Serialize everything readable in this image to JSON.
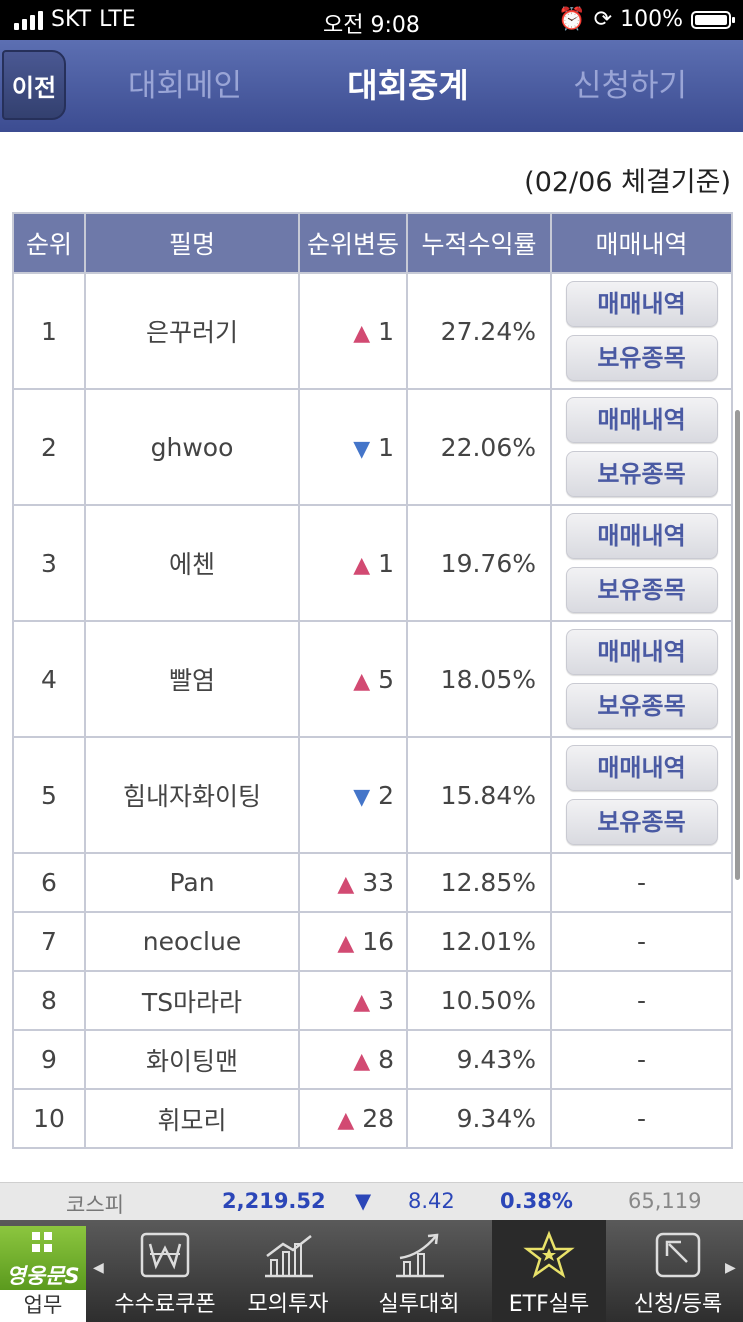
{
  "status_bar": {
    "carrier": "SKT",
    "network": "LTE",
    "time": "오전 9:08",
    "battery": "100%"
  },
  "nav": {
    "back_label": "이전",
    "tabs": [
      "대회메인",
      "대회중계",
      "신청하기"
    ],
    "active_tab": "대회중계"
  },
  "basis": "(02/06 체결기준)",
  "table": {
    "headers": [
      "순위",
      "필명",
      "순위변동",
      "누적수익률",
      "매매내역"
    ],
    "rows": [
      {
        "rank": "1",
        "name": "은꾸러기",
        "dir": "▲",
        "change": "1",
        "rate": "27.24%",
        "btn1": "매매내역",
        "btn2": "보유종목"
      },
      {
        "rank": "2",
        "name": "ghwoo",
        "dir": "▼",
        "change": "1",
        "rate": "22.06%",
        "btn1": "매매내역",
        "btn2": "보유종목"
      },
      {
        "rank": "3",
        "name": "에첸",
        "dir": "▲",
        "change": "1",
        "rate": "19.76%",
        "btn1": "매매내역",
        "btn2": "보유종목"
      },
      {
        "rank": "4",
        "name": "빨염",
        "dir": "▲",
        "change": "5",
        "rate": "18.05%",
        "btn1": "매매내역",
        "btn2": "보유종목"
      },
      {
        "rank": "5",
        "name": "힘내자화이팅",
        "dir": "▼",
        "change": "2",
        "rate": "15.84%",
        "btn1": "매매내역",
        "btn2": "보유종목"
      },
      {
        "rank": "6",
        "name": "Pan",
        "dir": "▲",
        "change": "33",
        "rate": "12.85%",
        "trades": "-"
      },
      {
        "rank": "7",
        "name": "neoclue",
        "dir": "▲",
        "change": "16",
        "rate": "12.01%",
        "trades": "-"
      },
      {
        "rank": "8",
        "name": "TS마라라",
        "dir": "▲",
        "change": "3",
        "rate": "10.50%",
        "trades": "-"
      },
      {
        "rank": "9",
        "name": "화이팅맨",
        "dir": "▲",
        "change": "8",
        "rate": "9.43%",
        "trades": "-"
      },
      {
        "rank": "10",
        "name": "휘모리",
        "dir": "▲",
        "change": "28",
        "rate": "9.34%",
        "trades": "-"
      }
    ]
  },
  "ticker": {
    "name": "코스피",
    "value": "2,219.52",
    "dir": "▼",
    "change": "8.42",
    "pct": "0.38%",
    "volume": "65,119"
  },
  "tabbar": {
    "logo_text": "영웅문S",
    "logo_label": "업무",
    "items": [
      {
        "label": "수수료쿠폰",
        "icon": "coupon-icon"
      },
      {
        "label": "모의투자",
        "icon": "chart-bars-icon"
      },
      {
        "label": "실투대회",
        "icon": "growth-arrow-icon"
      },
      {
        "label": "ETF실투",
        "icon": "star-icon"
      },
      {
        "label": "신청/등록",
        "icon": "register-icon"
      }
    ],
    "active": "ETF실투"
  },
  "colors": {
    "header": "#4a5a9e",
    "table_header": "#6e79a9",
    "up": "#d24a72",
    "down": "#4475c9",
    "button_text": "#4a5aa3"
  }
}
